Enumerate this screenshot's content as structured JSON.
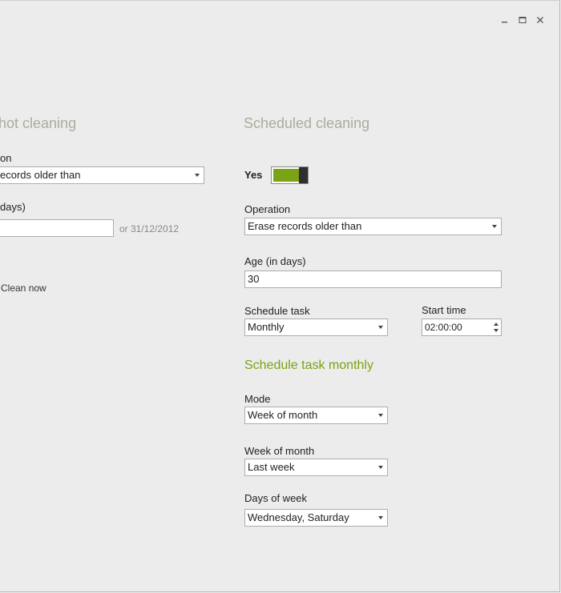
{
  "window_controls": {
    "minimize_icon": "minimize-icon",
    "maximize_icon": "maximize-icon",
    "close_icon": "close-icon"
  },
  "oneshot": {
    "title": "hot cleaning",
    "operation_label": "on",
    "operation_value": "ecords older than",
    "age_label": "days)",
    "age_value": "",
    "or_date": "or 31/12/2012",
    "clean_now": "Clean now"
  },
  "scheduled": {
    "title": "Scheduled cleaning",
    "toggle_label": "Yes",
    "toggle_on": true,
    "accent_color": "#7aa316",
    "operation_label": "Operation",
    "operation_value": "Erase records older than",
    "age_label": "Age (in days)",
    "age_value": "30",
    "schedule_task_label": "Schedule task",
    "schedule_task_value": "Monthly",
    "start_time_label": "Start time",
    "start_time_value": "02:00:00"
  },
  "monthly": {
    "title": "Schedule task monthly",
    "mode_label": "Mode",
    "mode_value": "Week of month",
    "week_of_month_label": "Week of month",
    "week_of_month_value": "Last week",
    "days_of_week_label": "Days of week",
    "days_of_week_value": "Wednesday, Saturday"
  }
}
